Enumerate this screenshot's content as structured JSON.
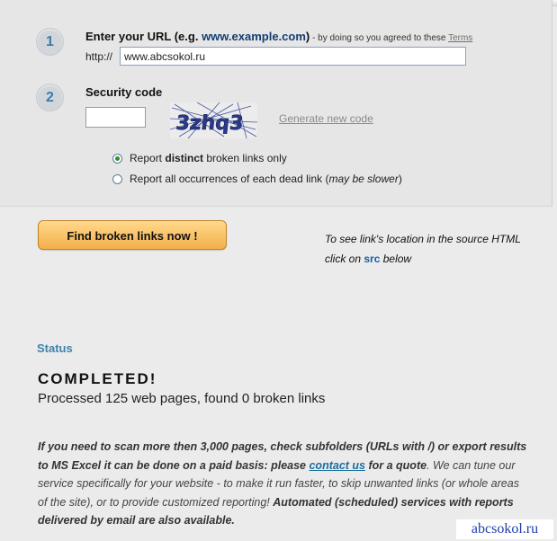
{
  "steps": {
    "step1_number": "1",
    "step2_number": "2"
  },
  "url_section": {
    "title_prefix": "Enter your URL (e.g. ",
    "title_example": "www.example.com",
    "title_suffix": ")",
    "agreement_text": " - by doing so you agreed to these ",
    "terms_link": "Terms",
    "prefix": "http://",
    "input_value": "www.abcsokol.ru"
  },
  "security_section": {
    "title": "Security code",
    "input_value": "",
    "captcha_text": "3zhq3",
    "generate_link": "Generate new code"
  },
  "report_options": {
    "option1_pre": "Report ",
    "option1_bold": "distinct",
    "option1_post": " broken links only",
    "option2_pre": "Report all occurrences of each dead link (",
    "option2_italic": "may be slower",
    "option2_post": ")",
    "selected": "distinct"
  },
  "action": {
    "find_button": "Find broken links now !",
    "src_note_pre": "To see link's location in the source HTML click on ",
    "src_word": "src",
    "src_note_post": " below"
  },
  "status": {
    "label": "Status",
    "state": "COMPLETED!",
    "summary": "Processed 125 web pages, found 0 broken links"
  },
  "paid_info": {
    "part1": "If you need to scan more then 3,000 pages, check subfolders (URLs with /) or export results to MS Excel it can be done on a paid basis: please ",
    "contact_link": "contact us",
    "part2": " for a quote",
    "part3": ". We can tune our service specifically for your website - to make it run faster, to skip unwanted links (or whole areas of the site), or to provide customized reporting! ",
    "part4": "Automated (scheduled) services with reports delivered by email are also available."
  },
  "watermark": "abcsokol.ru"
}
